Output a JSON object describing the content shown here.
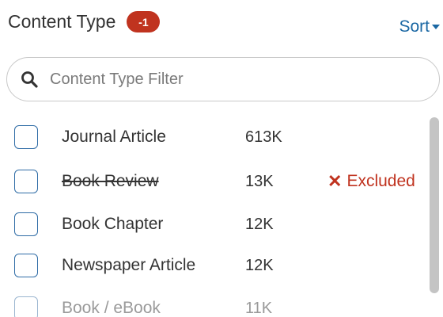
{
  "header": {
    "title": "Content Type",
    "badge": "-1",
    "sort_label": "Sort"
  },
  "filter": {
    "placeholder": "Content Type Filter",
    "icon": "search-icon"
  },
  "items": [
    {
      "label": "Journal Article",
      "count": "613K",
      "checked": false,
      "excluded": false
    },
    {
      "label": "Book Review",
      "count": "13K",
      "checked": false,
      "excluded": true,
      "excluded_label": "Excluded",
      "excluded_mark": "✕"
    },
    {
      "label": "Book Chapter",
      "count": "12K",
      "checked": false,
      "excluded": false
    },
    {
      "label": "Newspaper Article",
      "count": "12K",
      "checked": false,
      "excluded": false
    },
    {
      "label": "Book / eBook",
      "count": "11K",
      "checked": false,
      "excluded": false
    }
  ],
  "colors": {
    "accent": "#1a67a3",
    "badge": "#c0331f",
    "excluded": "#c0331f",
    "checkbox_border": "#2f6ca6"
  }
}
